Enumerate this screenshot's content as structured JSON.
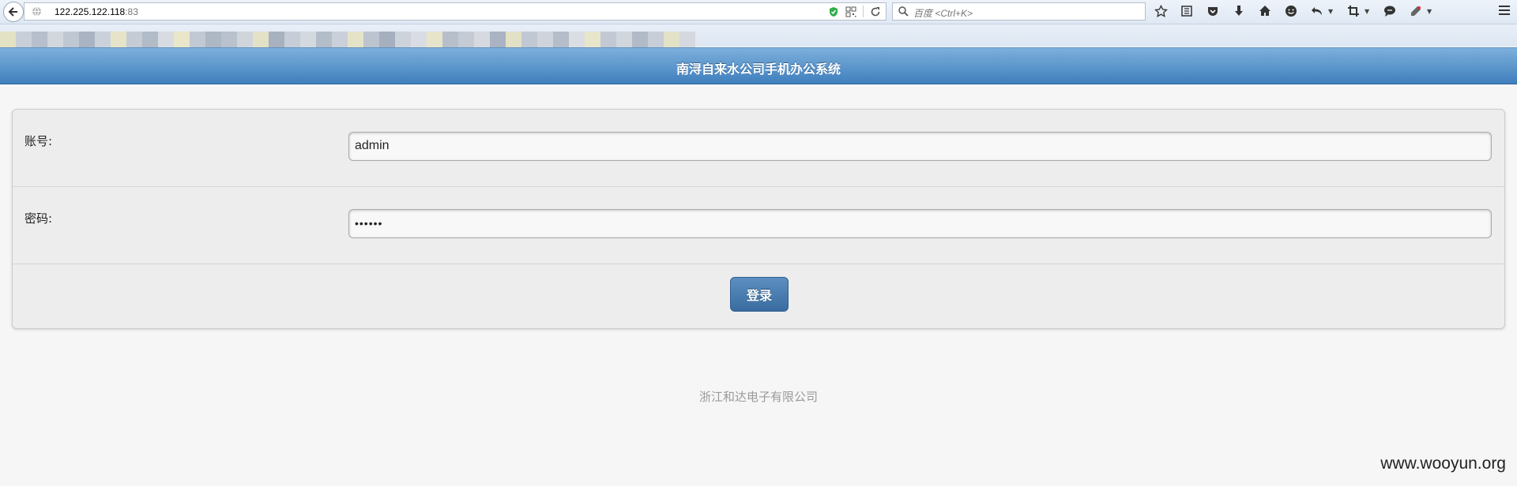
{
  "browser": {
    "url_host": "122.225.122.118",
    "url_port": ":83",
    "search_placeholder": "百度 <Ctrl+K>"
  },
  "app": {
    "title": "南浔自来水公司手机办公系统"
  },
  "form": {
    "account_label": "账号:",
    "account_value": "admin",
    "password_label": "密码:",
    "password_value": "••••••",
    "login_label": "登录"
  },
  "footer": {
    "company": "浙江和达电子有限公司",
    "watermark": "www.wooyun.org"
  },
  "colors": {
    "header": "#4a88c4",
    "button": "#4a7fb3",
    "background": "#f6f6f6"
  }
}
